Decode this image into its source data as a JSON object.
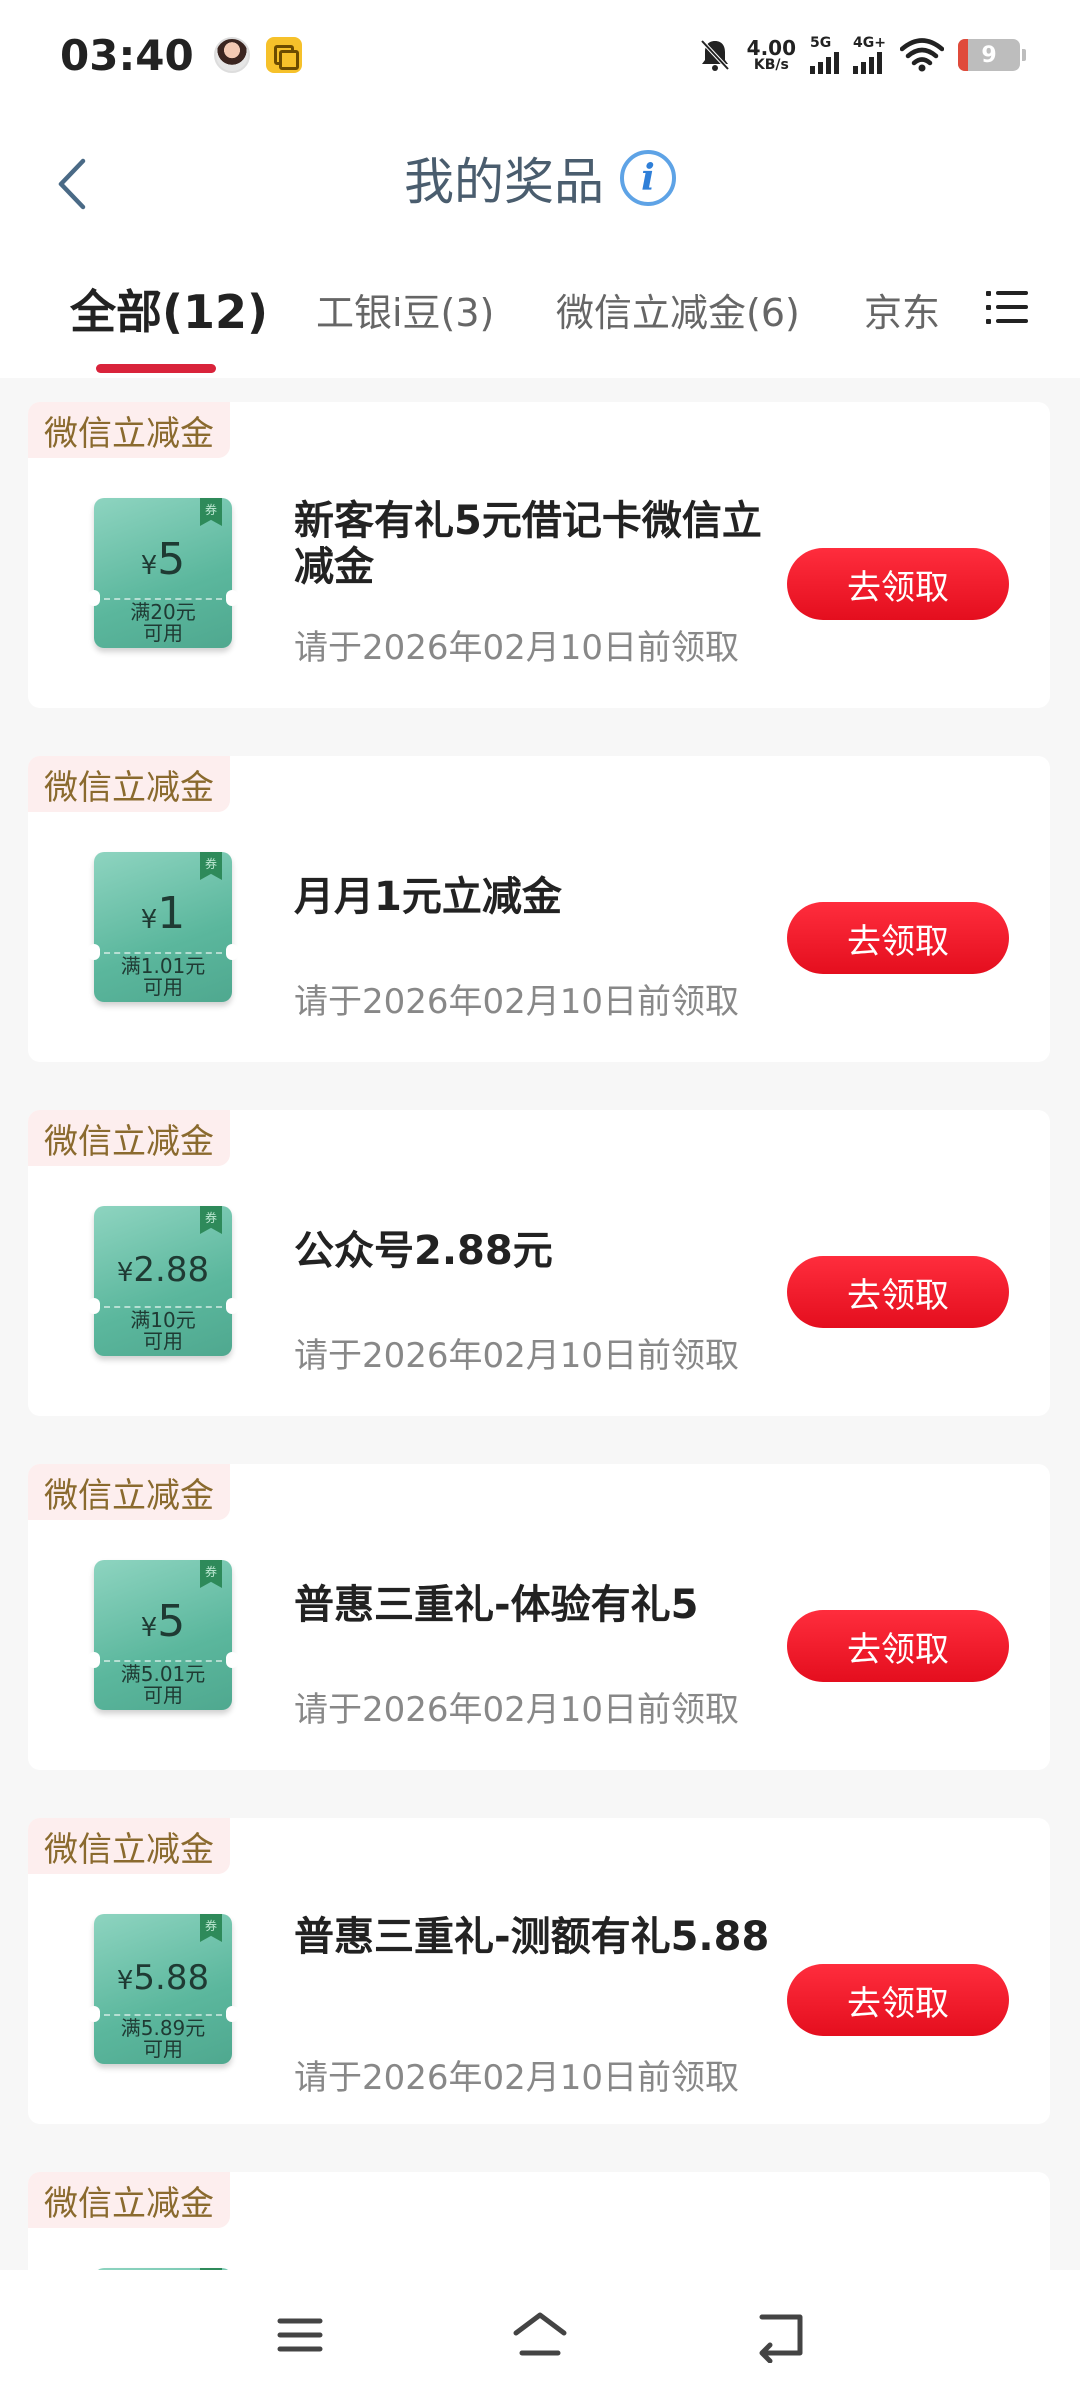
{
  "status_bar": {
    "time": "03:40",
    "net_speed_value": "4.00",
    "net_speed_unit": "KB/s",
    "sim1": "5G",
    "sim2": "4G+",
    "battery": "9"
  },
  "header": {
    "title": "我的奖品"
  },
  "tabs": [
    {
      "label": "全部(12)"
    },
    {
      "label": "工银i豆(3)"
    },
    {
      "label": "微信立减金(6)"
    },
    {
      "label": "京东"
    }
  ],
  "cards": [
    {
      "tag": "微信立减金",
      "amount": "5",
      "condition_line1": "满20元",
      "condition_line2": "可用",
      "title": "新客有礼5元借记卡微信立减金",
      "deadline": "请于2026年02月10日前领取",
      "button": "去领取"
    },
    {
      "tag": "微信立减金",
      "amount": "1",
      "condition_line1": "满1.01元",
      "condition_line2": "可用",
      "title": "月月1元立减金",
      "deadline": "请于2026年02月10日前领取",
      "button": "去领取"
    },
    {
      "tag": "微信立减金",
      "amount": "2.88",
      "condition_line1": "满10元",
      "condition_line2": "可用",
      "title": "公众号2.88元",
      "deadline": "请于2026年02月10日前领取",
      "button": "去领取"
    },
    {
      "tag": "微信立减金",
      "amount": "5",
      "condition_line1": "满5.01元",
      "condition_line2": "可用",
      "title": "普惠三重礼-体验有礼5",
      "deadline": "请于2026年02月10日前领取",
      "button": "去领取"
    },
    {
      "tag": "微信立减金",
      "amount": "5.88",
      "condition_line1": "满5.89元",
      "condition_line2": "可用",
      "title": "普惠三重礼-测额有礼5.88",
      "deadline": "请于2026年02月10日前领取",
      "button": "去领取"
    },
    {
      "tag": "微信立减金"
    }
  ],
  "coupon_ribbon": "券",
  "currency": "¥",
  "colors": {
    "accent": "#d9233b",
    "button": "#ff2d3d",
    "coupon": "#5bb79d",
    "tag_bg": "#fdeeee",
    "tag_text": "#8a6a2e"
  },
  "icons": [
    "back-arrow-icon",
    "info-icon",
    "menu-list-icon",
    "nav-menu-icon",
    "nav-home-icon",
    "nav-back-icon"
  ]
}
